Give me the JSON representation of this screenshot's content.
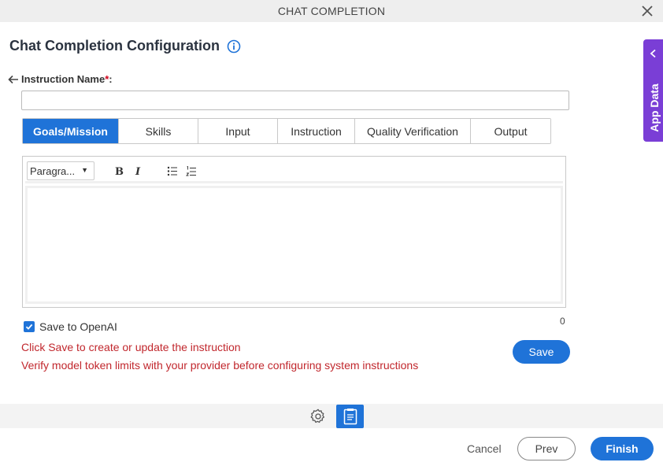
{
  "window": {
    "title": "CHAT COMPLETION"
  },
  "page": {
    "heading": "Chat Completion Configuration"
  },
  "instruction": {
    "label": "Instruction Name",
    "required_mark": "*",
    "colon": ":",
    "value": "",
    "placeholder": ""
  },
  "tabs": [
    {
      "label": "Goals/Mission",
      "active": true
    },
    {
      "label": "Skills",
      "active": false
    },
    {
      "label": "Input",
      "active": false
    },
    {
      "label": "Instruction",
      "active": false
    },
    {
      "label": "Quality Verification",
      "active": false
    },
    {
      "label": "Output",
      "active": false
    }
  ],
  "editor": {
    "paragraph_select": "Paragra...",
    "bold": "B",
    "italic": "I",
    "char_count": "0"
  },
  "save_to_openai": {
    "label": "Save to OpenAI",
    "checked": true
  },
  "messages": {
    "line1": "Click Save to create or update the instruction",
    "line2": "Verify model token limits with your provider before configuring system instructions"
  },
  "buttons": {
    "save": "Save",
    "cancel": "Cancel",
    "prev": "Prev",
    "finish": "Finish"
  },
  "side_panel": {
    "label": "App Data"
  },
  "colors": {
    "primary": "#1f73d8",
    "side_panel": "#7a3ed6",
    "error": "#c1272d"
  }
}
